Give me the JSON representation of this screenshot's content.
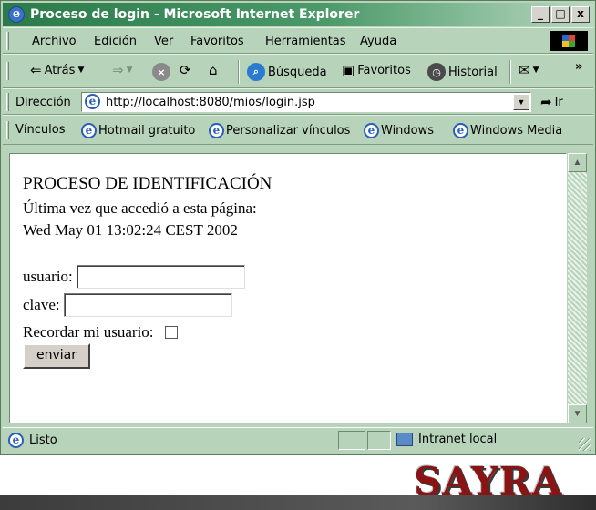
{
  "window": {
    "title": "Proceso de login - Microsoft Internet Explorer",
    "controls": {
      "minimize": "_",
      "maximize": "□",
      "close": "x"
    }
  },
  "menubar": {
    "items": [
      "Archivo",
      "Edición",
      "Ver",
      "Favoritos",
      "Herramientas",
      "Ayuda"
    ]
  },
  "toolbar": {
    "back_label": "Atrás",
    "forward_label": "",
    "search_label": "Búsqueda",
    "favorites_label": "Favoritos",
    "history_label": "Historial",
    "more": "»"
  },
  "addressbar": {
    "label": "Dirección",
    "url": "http://localhost:8080/mios/login.jsp",
    "go_label": "Ir"
  },
  "linksbar": {
    "label": "Vínculos",
    "links": [
      "Hotmail gratuito",
      "Personalizar vínculos",
      "Windows",
      "Windows Media"
    ]
  },
  "page": {
    "heading": "PROCESO DE IDENTIFICACIÓN",
    "last_visit_label": "Última vez que accedió a esta página:",
    "last_visit_date": "Wed May 01 13:02:24 CEST 2002",
    "user_label": "usuario:",
    "user_value": "",
    "password_label": "clave:",
    "password_value": "",
    "remember_label": "Recordar mi usuario:",
    "remember_checked": false,
    "submit_label": "enviar"
  },
  "statusbar": {
    "status": "Listo",
    "zone": "Intranet local"
  },
  "logo": {
    "text": "SAYRA"
  },
  "colors": {
    "chrome": "#b7d3b9",
    "title_start": "#2a7a4a",
    "logo": "#8a1414"
  },
  "icons": [
    "ie-icon",
    "back-arrow-icon",
    "forward-arrow-icon",
    "stop-icon",
    "refresh-icon",
    "home-icon",
    "search-icon",
    "favorites-icon",
    "history-icon",
    "mail-icon",
    "go-icon",
    "intranet-icon",
    "windows-logo-icon"
  ]
}
